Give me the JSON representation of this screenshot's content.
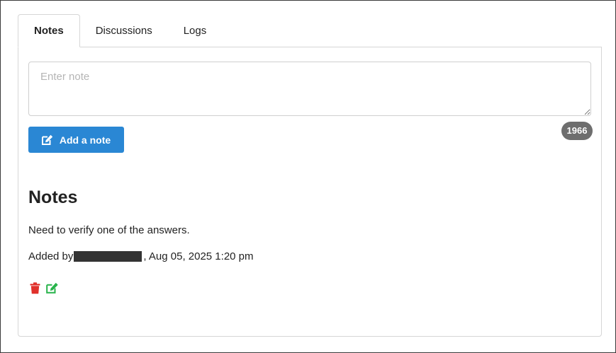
{
  "tabs": [
    {
      "label": "Notes",
      "active": true
    },
    {
      "label": "Discussions",
      "active": false
    },
    {
      "label": "Logs",
      "active": false
    }
  ],
  "note_form": {
    "placeholder": "Enter note",
    "value": "",
    "char_count": "1966",
    "add_button_label": "Add a note",
    "add_button_icon": "edit-icon",
    "accent_color": "#2a87d4"
  },
  "notes_section": {
    "title": "Notes",
    "items": [
      {
        "text": "Need to verify one of the answers.",
        "added_by_prefix": "Added by",
        "date_text": ", Aug 05, 2025 1:20 pm",
        "delete_icon": "trash-icon",
        "edit_icon": "edit-icon",
        "delete_color": "#e0312b",
        "edit_color": "#27b34a"
      }
    ]
  }
}
